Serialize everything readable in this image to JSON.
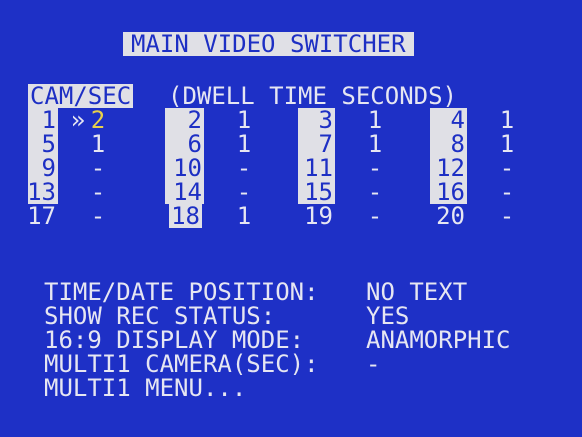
{
  "title": "MAIN VIDEO SWITCHER",
  "header": {
    "cam_sec": "CAM/SEC",
    "dwell": "(DWELL TIME SECONDS)"
  },
  "cursor_marker": "»",
  "grid": [
    [
      {
        "cam": "1",
        "dwell": "2",
        "sel": true
      },
      {
        "cam": "2",
        "dwell": "1"
      },
      {
        "cam": "3",
        "dwell": "1"
      },
      {
        "cam": "4",
        "dwell": "1"
      }
    ],
    [
      {
        "cam": "5",
        "dwell": "1"
      },
      {
        "cam": "6",
        "dwell": "1"
      },
      {
        "cam": "7",
        "dwell": "1"
      },
      {
        "cam": "8",
        "dwell": "1"
      }
    ],
    [
      {
        "cam": "9",
        "dwell": "-"
      },
      {
        "cam": "10",
        "dwell": "-"
      },
      {
        "cam": "11",
        "dwell": "-"
      },
      {
        "cam": "12",
        "dwell": "-"
      }
    ],
    [
      {
        "cam": "13",
        "dwell": "-"
      },
      {
        "cam": "14",
        "dwell": "-"
      },
      {
        "cam": "15",
        "dwell": "-"
      },
      {
        "cam": "16",
        "dwell": "-"
      }
    ],
    [
      {
        "cam": "17",
        "dwell": "-",
        "hl": false
      },
      {
        "cam": "18",
        "dwell": "1"
      },
      {
        "cam": "19",
        "dwell": "-",
        "hl": false
      },
      {
        "cam": "20",
        "dwell": "-",
        "hl": false
      }
    ]
  ],
  "menu": [
    {
      "label": "TIME/DATE POSITION:",
      "value": "NO TEXT"
    },
    {
      "label": "SHOW REC STATUS:",
      "value": "YES"
    },
    {
      "label": "16:9 DISPLAY MODE:",
      "value": "ANAMORPHIC"
    },
    {
      "label": "MULTI1 CAMERA(SEC):",
      "value": "-"
    },
    {
      "label": "MULTI1 MENU...",
      "value": ""
    }
  ],
  "colors": {
    "background": "#1e30c6",
    "text": "#e6e6f2",
    "highlight": "#e0e0e6",
    "cursor": "#e8d04a"
  }
}
